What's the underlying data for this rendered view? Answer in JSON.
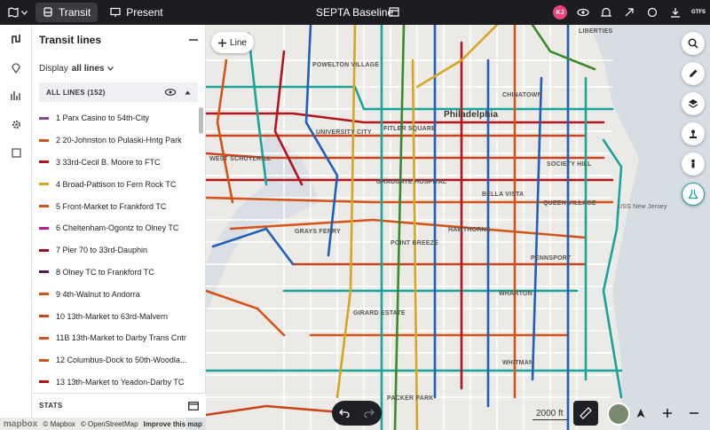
{
  "app": {
    "title": "SEPTA Baseline",
    "modes": [
      {
        "label": "Transit"
      },
      {
        "label": "Present"
      }
    ],
    "user_initials": "KJ",
    "gtfs_label": "GTFS"
  },
  "panel": {
    "title": "Transit lines",
    "display_prefix": "Display",
    "display_value": "all lines",
    "group_header": "ALL LINES (152)",
    "stats_label": "STATS",
    "lines": [
      {
        "label": "1 Parx Casino to 54th-City",
        "color": "#8a4a8e"
      },
      {
        "label": "2 20-Johnston to Pulaski-Hntg Park",
        "color": "#d3541a"
      },
      {
        "label": "3 33rd-Cecil B. Moore to FTC",
        "color": "#b3151d"
      },
      {
        "label": "4 Broad-Pattison to Fern Rock TC",
        "color": "#d4a720"
      },
      {
        "label": "5 Front-Market to Frankford TC",
        "color": "#d3541a"
      },
      {
        "label": "6 Cheltenham-Ogontz to Olney TC",
        "color": "#b81b8d"
      },
      {
        "label": "7 Pier 70 to 33rd-Dauphin",
        "color": "#9a1020"
      },
      {
        "label": "8 Olney TC to Frankford TC",
        "color": "#5a1a5a"
      },
      {
        "label": "9 4th-Walnut to Andorra",
        "color": "#d3541a"
      },
      {
        "label": "10 13th-Market to 63rd-Malvern",
        "color": "#c8451b"
      },
      {
        "label": "11B 13th-Market to Darby Trans Cntr",
        "color": "#d3541a"
      },
      {
        "label": "12 Columbus-Dock to 50th-Woodla...",
        "color": "#d3541a"
      },
      {
        "label": "13 13th-Market to Yeadon-Darby TC",
        "color": "#b3151d"
      }
    ]
  },
  "map": {
    "add_line_label": "Line",
    "scale_label": "2000 ft",
    "attribution": {
      "logo": "mapbox",
      "mapbox": "© Mapbox",
      "osm": "© OpenStreetMap",
      "improve": "Improve this map"
    },
    "labels": {
      "powelton": "POWELTON VILLAGE",
      "philadelphia": "Philadelphia",
      "university_city": "UNIVERSITY CITY",
      "fitler": "FITLER SQUARE",
      "schuylkill": "WEST SCHUYLKILL",
      "graduate": "GRADUATE HOSPITAL",
      "bella_vista": "BELLA VISTA",
      "queen_village": "QUEEN VILLAGE",
      "grays_ferry": "GRAYS FERRY",
      "point_breeze": "POINT BREEZE",
      "hawthorne": "HAWTHORNE",
      "pennsport": "PENNSPORT",
      "wharton": "WHARTON",
      "girard_estate": "GIRARD ESTATE",
      "whitman": "WHITMAN",
      "packer_park": "PACKER PARK",
      "chinatown": "CHINATOWN",
      "society_hill": "SOCIETY HILL",
      "uss_nj": "USS New Jersey",
      "liberties": "LIBERTIES"
    }
  },
  "colors": {
    "accent": "#19a39a",
    "topbar": "#1c1d20",
    "avatar": "#e9457a"
  }
}
